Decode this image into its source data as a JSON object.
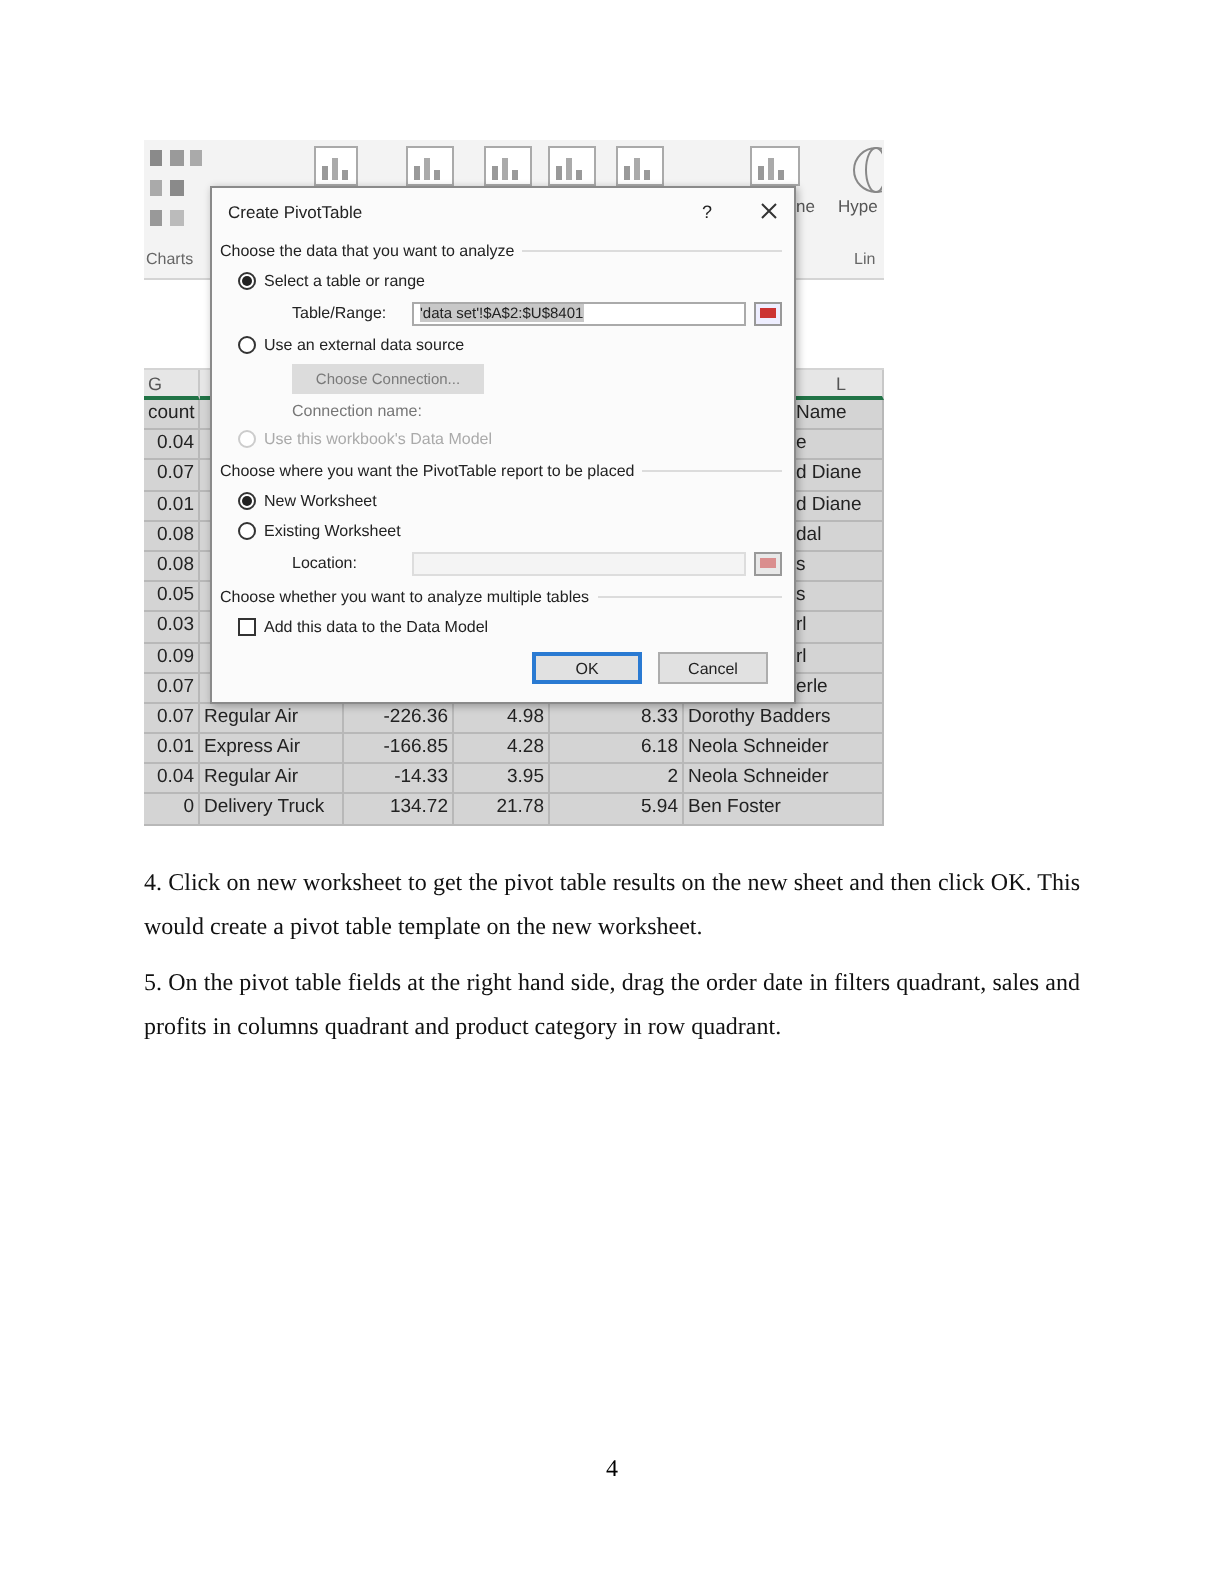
{
  "screenshot": {
    "ribbon": {
      "button_labels": [
        "ne",
        "Hype"
      ],
      "group_labels": [
        "Charts",
        "Lin"
      ]
    },
    "sheet": {
      "columns": [
        "G",
        "L"
      ],
      "rows": [
        {
          "g": "count",
          "l": "Name"
        },
        {
          "g": "0.04",
          "l": "e"
        },
        {
          "g": "0.07",
          "l": "d Diane"
        },
        {
          "g": "0.01",
          "l": "d Diane"
        },
        {
          "g": "0.08",
          "l": "dal"
        },
        {
          "g": "0.08",
          "l": "s"
        },
        {
          "g": "0.05",
          "l": "s"
        },
        {
          "g": "0.03",
          "l": "rl"
        },
        {
          "g": "0.09",
          "l": "rl"
        },
        {
          "g": "0.07",
          "l": "erle"
        },
        {
          "g": "0.07",
          "h": "Regular Air",
          "i": "-226.36",
          "j": "4.98",
          "k": "8.33",
          "l": "Dorothy Badders"
        },
        {
          "g": "0.01",
          "h": "Express Air",
          "i": "-166.85",
          "j": "4.28",
          "k": "6.18",
          "l": "Neola Schneider"
        },
        {
          "g": "0.04",
          "h": "Regular Air",
          "i": "-14.33",
          "j": "3.95",
          "k": "2",
          "l": "Neola Schneider"
        },
        {
          "g": "0",
          "h": "Delivery Truck",
          "i": "134.72",
          "j": "21.78",
          "k": "5.94",
          "l": "Ben Foster"
        }
      ]
    },
    "dialog": {
      "title": "Create PivotTable",
      "help": "?",
      "items": [
        {
          "kind": "heading",
          "text": "Choose the data that you want to analyze"
        },
        {
          "kind": "radio",
          "label": "Select a table or range",
          "selected": true,
          "disabled": false
        },
        {
          "kind": "field",
          "label": "Table/Range:",
          "value": "'data set'!$A$2:$U$8401",
          "disabled": false
        },
        {
          "kind": "radio",
          "label": "Use an external data source",
          "selected": false,
          "disabled": false
        },
        {
          "kind": "button",
          "label": "Choose Connection...",
          "disabled": true
        },
        {
          "kind": "caption",
          "text": "Connection name:"
        },
        {
          "kind": "radio",
          "label": "Use this workbook's Data Model",
          "selected": false,
          "disabled": true
        },
        {
          "kind": "heading",
          "text": "Choose where you want the PivotTable report to be placed"
        },
        {
          "kind": "radio",
          "label": "New Worksheet",
          "selected": true,
          "disabled": false
        },
        {
          "kind": "radio",
          "label": "Existing Worksheet",
          "selected": false,
          "disabled": false
        },
        {
          "kind": "field",
          "label": "Location:",
          "disabled": true
        },
        {
          "kind": "heading",
          "text": "Choose whether you want to analyze multiple tables"
        },
        {
          "kind": "checkbox",
          "label": "Add this data to the Data Model",
          "checked": false
        }
      ],
      "buttons": [
        {
          "label": "OK",
          "focused": true
        },
        {
          "label": "Cancel",
          "focused": false
        }
      ]
    }
  },
  "paragraphs": [
    "4. Click on new worksheet to get the pivot table results on the new sheet and then click OK. This would create a pivot table template on the new worksheet.",
    "5. On the pivot table fields at the right hand side, drag the order date in filters quadrant, sales and profits in columns quadrant and product category in row quadrant."
  ],
  "page_number": "4"
}
